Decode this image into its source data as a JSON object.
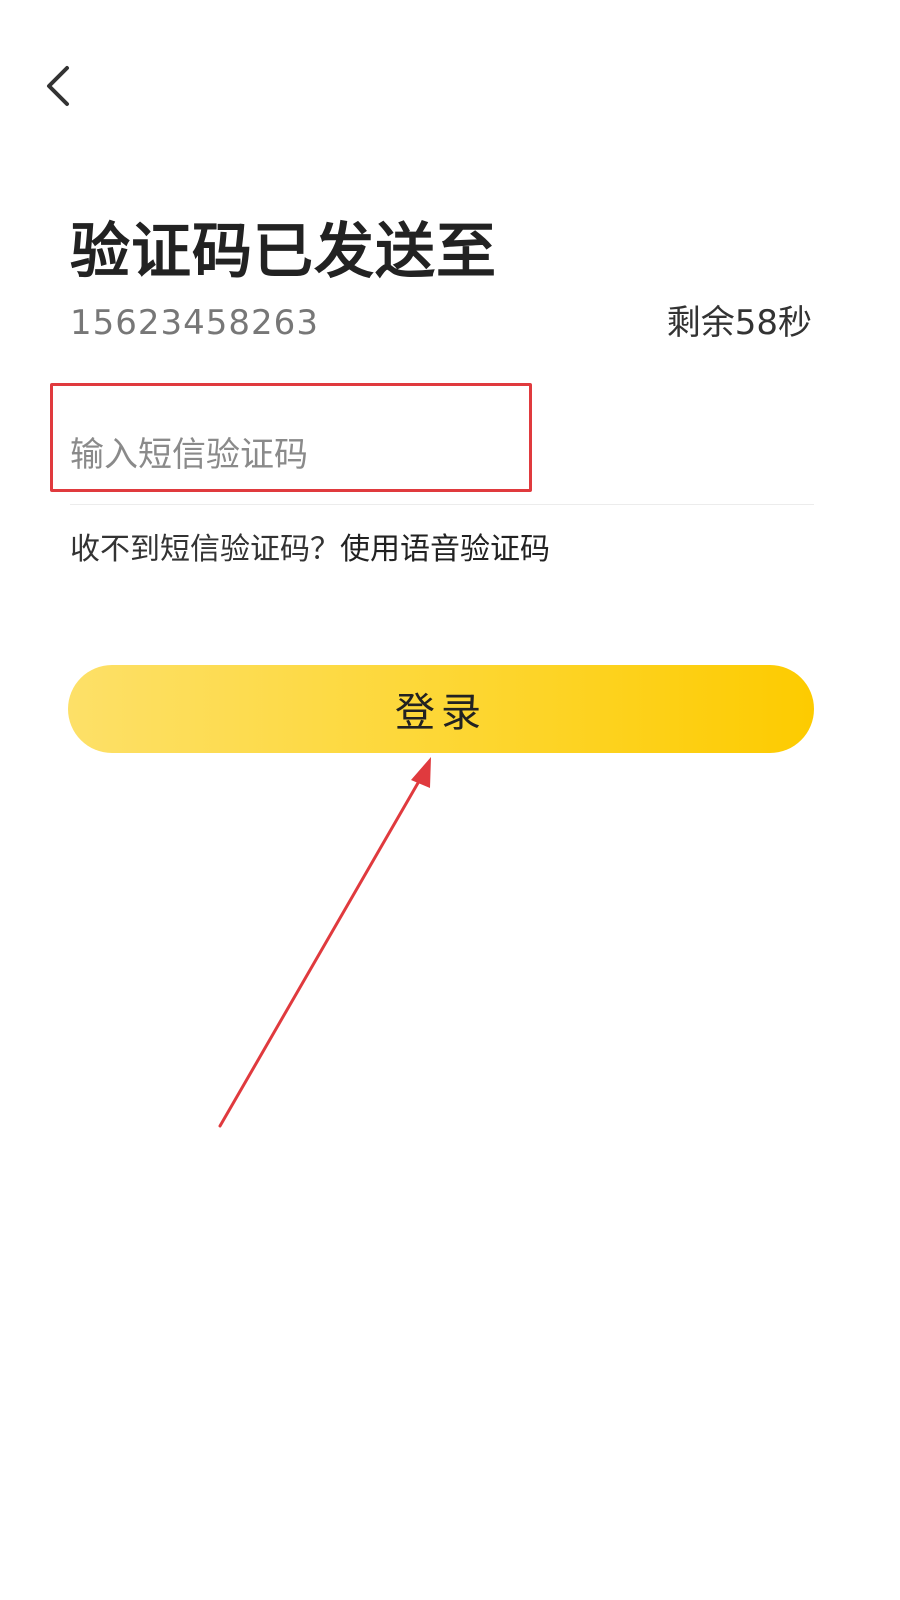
{
  "header": {
    "back_icon": "chevron-left-icon"
  },
  "main": {
    "title": "验证码已发送至",
    "phone": "15623458263",
    "countdown": "剩余58秒",
    "code_input": {
      "placeholder": "输入短信验证码",
      "value": ""
    },
    "voice_prompt": "收不到短信验证码？",
    "voice_link": "使用语音验证码",
    "login_label": "登录"
  },
  "annotation": {
    "highlight_color": "#e03a3e",
    "arrow_color": "#e03a3e"
  },
  "colors": {
    "button_gradient_start": "#fde068",
    "button_gradient_end": "#fdcb00"
  }
}
